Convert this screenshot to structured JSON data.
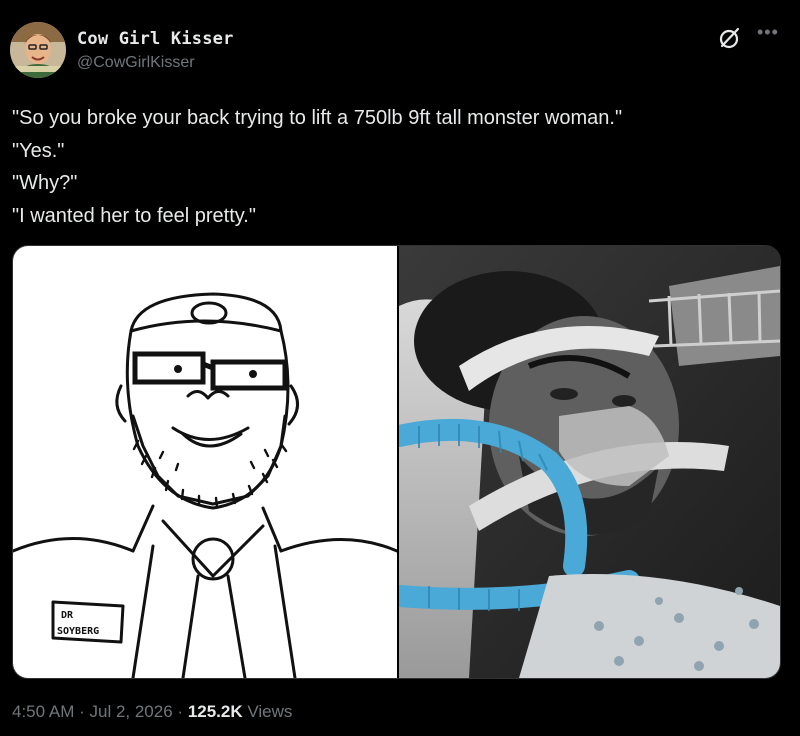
{
  "author": {
    "display_name": "Cow Girl Kisser",
    "handle": "@CowGirlKisser"
  },
  "tweet": {
    "lines": [
      "\"So you broke your back trying to lift a 750lb 9ft tall monster woman.\"",
      "\"Yes.\"",
      "\"Why?\"",
      "\"I wanted her to feel pretty.\""
    ]
  },
  "media": {
    "left_badge_line1": "DR",
    "left_badge_line2": "SOYBERG"
  },
  "meta": {
    "time": "4:50 AM",
    "date": "Jul 2, 2026",
    "views_count": "125.2K",
    "views_label": "Views"
  },
  "icons": {
    "grok": "grok-icon",
    "more": "more-icon"
  },
  "colors": {
    "background": "#000000",
    "text": "#e7e9ea",
    "secondary": "#71767b",
    "tube": "#4aa9d6"
  }
}
